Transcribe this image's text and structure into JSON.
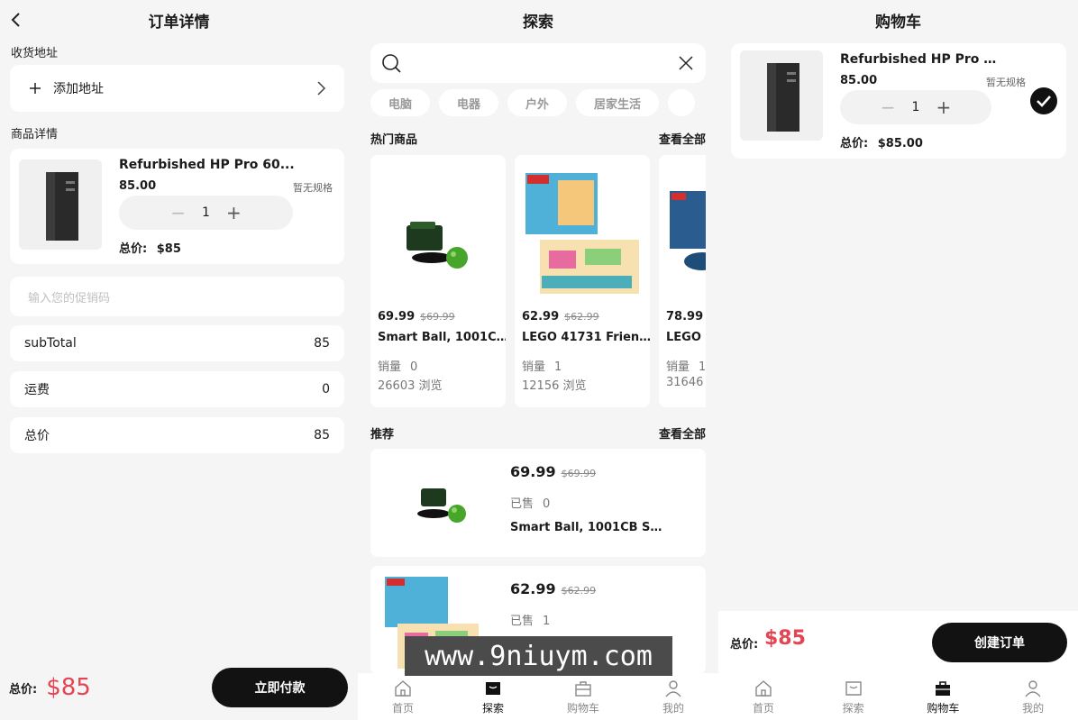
{
  "order": {
    "title": "订单详情",
    "address_label": "收货地址",
    "add_address": "添加地址",
    "product_section_label": "商品详情",
    "product": {
      "name": "Refurbished HP Pro 60...",
      "price": "85.00",
      "spec": "暂无规格",
      "quantity": "1",
      "total_label": "总价:",
      "total": "$85"
    },
    "promo_placeholder": "输入您的促销码",
    "summary": [
      {
        "label": "subTotal",
        "value": "85"
      },
      {
        "label": "运费",
        "value": "0"
      },
      {
        "label": "总价",
        "value": "85"
      }
    ],
    "bottom": {
      "total_label": "总价:",
      "total": "$85",
      "pay_button": "立即付款"
    }
  },
  "explore": {
    "title": "探索",
    "search": {
      "placeholder": ""
    },
    "categories": [
      "电脑",
      "电器",
      "户外",
      "居家生活",
      ""
    ],
    "hot": {
      "title": "热门商品",
      "view_all": "查看全部",
      "items": [
        {
          "price": "69.99",
          "old_price": "$69.99",
          "name": "Smart Ball, 1001CB ...",
          "sales_label": "销量",
          "sales": "0",
          "views": "26603 浏览"
        },
        {
          "price": "62.99",
          "old_price": "$62.99",
          "name": "LEGO 41731 Friends...",
          "sales_label": "销量",
          "sales": "1",
          "views": "12156 浏览"
        },
        {
          "price": "78.99",
          "old_price": "",
          "name": "LEGO",
          "sales_label": "销量",
          "sales": "1",
          "views": "31646"
        }
      ]
    },
    "recommend": {
      "title": "推荐",
      "view_all": "查看全部",
      "items": [
        {
          "price": "69.99",
          "old_price": "$69.99",
          "sold_label": "已售",
          "sold": "0",
          "name": "Smart Ball, 1001CB So..."
        },
        {
          "price": "62.99",
          "old_price": "$62.99",
          "sold_label": "已售",
          "sold": "1",
          "name": ""
        }
      ]
    }
  },
  "cart": {
    "title": "购物车",
    "item": {
      "name": "Refurbished HP Pro 60...",
      "price": "85.00",
      "spec": "暂无规格",
      "quantity": "1",
      "total_label": "总价:",
      "total": "$85.00"
    },
    "bottom": {
      "total_label": "总价:",
      "total": "$85",
      "create_button": "创建订单"
    }
  },
  "tabbar": {
    "items": [
      "首页",
      "探索",
      "购物车",
      "我的"
    ]
  },
  "watermark": "www.9niuym.com",
  "colors": {
    "accent_red": "#e54453",
    "button_black": "#121212",
    "background": "#f5f5f5"
  }
}
